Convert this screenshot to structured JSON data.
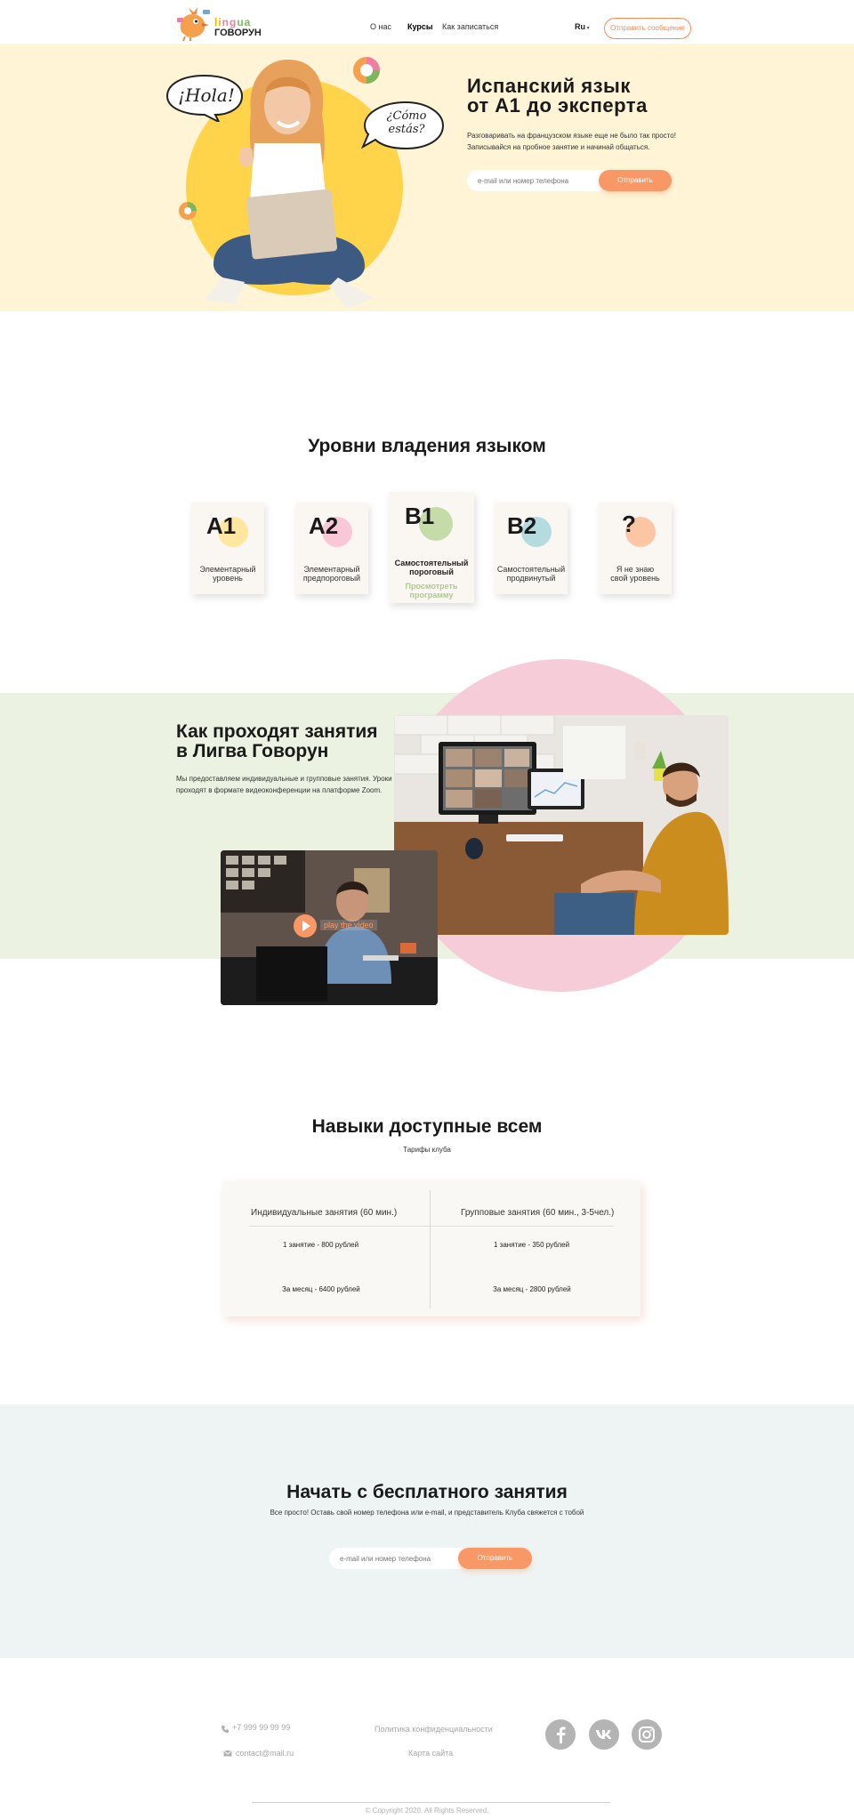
{
  "header": {
    "logo_word1": [
      "li",
      "ng",
      "ua"
    ],
    "logo_word2": "ГОВОРУН",
    "nav": [
      "О нас",
      "Курсы",
      "Как записаться"
    ],
    "lang": "Ru",
    "cta": "Отправить сообщение"
  },
  "hero": {
    "bubble1": "¡Hola!",
    "bubble2_line1": "¿Cómo",
    "bubble2_line2": "estás?",
    "title_line1": "Испанский язык",
    "title_line2": "от А1 до эксперта",
    "subtitle_line1": "Разговаривать на французском языке еще не было так просто!",
    "subtitle_line2": "Записывайся на пробное занятие и начинай общаться.",
    "input_placeholder": "e-mail или номер телефона",
    "send": "Отправить"
  },
  "levels": {
    "title": "Уровни владения языком",
    "items": [
      {
        "code": "A1",
        "line1": "Элементарный",
        "line2": "уровень",
        "color": "#ffe7a1"
      },
      {
        "code": "A2",
        "line1": "Элементарный",
        "line2": "предпороговый",
        "color": "#f8c8d8"
      },
      {
        "code": "B1",
        "line1": "Самостоятельный",
        "line2": "пороговый",
        "color": "#c6dca8",
        "link1": "Просмотреть",
        "link2": "программу"
      },
      {
        "code": "B2",
        "line1": "Самостоятельный",
        "line2": "продвинутый",
        "color": "#b5dbe0"
      },
      {
        "code": "?",
        "line1": "Я не знаю",
        "line2": "свой уровень",
        "color": "#fcc6a4"
      }
    ]
  },
  "lessons": {
    "title_line1": "Как проходят занятия",
    "title_line2": "в Лигва Говорун",
    "text": "Мы предоставляем индивидуальные и групповые занятия. Уроки проходят в формате видеоконференции на платформе Zoom.",
    "play_label": "play the video"
  },
  "pricing": {
    "title": "Навыки доступные всем",
    "subtitle": "Тарифы клуба",
    "col1": {
      "head": "Индивидуальные занятия (60 мин.)",
      "line1": "1 занятие - 800 рублей",
      "line2": "За месяц - 6400 рублей"
    },
    "col2": {
      "head": "Групповые занятия (60 мин., 3-5чел.)",
      "line1": "1 занятие - 350 рублей",
      "line2": "За месяц - 2800 рублей"
    }
  },
  "cta": {
    "title": "Начать с бесплатного занятия",
    "subtitle": "Все просто! Оставь свой номер телефона или e-mail, и представитель Клуба свяжется с тобой",
    "input_placeholder": "e-mail или номер телефона",
    "send": "Отправить"
  },
  "footer": {
    "phone": "+7 999 99 99 99",
    "email": "contact@mail.ru",
    "privacy": "Политика конфиденциальности",
    "sitemap": "Карта сайта",
    "copyright": "© Copyright 2020. All Rights Reserved."
  },
  "colors": {
    "accent": "#f68b57",
    "hero_bg": "#fff4d6",
    "lessons_bg": "#ecf2e1",
    "cta_bg": "#eef4f3"
  }
}
